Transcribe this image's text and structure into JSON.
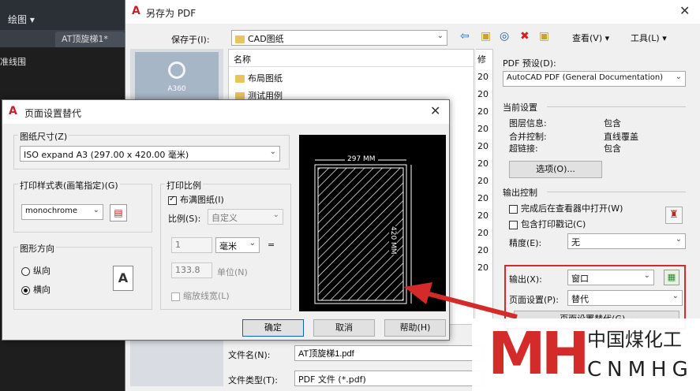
{
  "cad": {
    "menu_label": "绘图",
    "tab_label": "AT顶旋梯1*",
    "side_text": "准线围"
  },
  "save_dialog": {
    "title": "另存为 PDF",
    "save_in_label": "保存于(I):",
    "save_in_value": "CAD图纸",
    "view_label": "查看(V)",
    "tools_label": "工具(L)",
    "places": {
      "a360_label": "A360"
    },
    "list": {
      "name_header": "名称",
      "mod_header": "修",
      "items": [
        {
          "name": "布局图纸"
        },
        {
          "name": "测试用例"
        }
      ],
      "mod_values": [
        "20",
        "20",
        "20",
        "20",
        "20",
        "20",
        "20",
        "20",
        "20",
        "20",
        "20",
        "20"
      ]
    },
    "filename_label": "文件名(N):",
    "filename_value": "AT顶旋梯1.pdf",
    "filetype_label": "文件类型(T):",
    "filetype_value": "PDF 文件 (*.pdf)",
    "pdf_preset_label": "PDF 预设(D):",
    "pdf_preset_value": "AutoCAD PDF (General Documentation)",
    "current_settings": {
      "title": "当前设置",
      "rows": [
        {
          "key": "图层信息:",
          "value": "包含"
        },
        {
          "key": "合并控制:",
          "value": "直线覆盖"
        },
        {
          "key": "超链接:",
          "value": "包含"
        }
      ],
      "options_button": "选项(O)..."
    },
    "output_control": {
      "title": "输出控制",
      "open_after": "完成后在查看器中打开(W)",
      "include_stamp": "包含打印戳记(C)",
      "precision_label": "精度(E):",
      "precision_value": "无"
    },
    "output_label": "输出(X):",
    "output_value": "窗口",
    "page_setup_label": "页面设置(P):",
    "page_setup_value": "替代",
    "page_setup_override_button": "页面设置替代(G)..."
  },
  "override_dialog": {
    "title": "页面设置替代",
    "paper_size_label": "图纸尺寸(Z)",
    "paper_size_value": "ISO expand A3 (297.00 x 420.00 毫米)",
    "plot_style_label": "打印样式表(画笔指定)(G)",
    "plot_style_value": "monochrome",
    "orientation_label": "图形方向",
    "portrait_label": "纵向",
    "landscape_label": "横向",
    "orientation_icon_letter": "A",
    "plot_scale_label": "打印比例",
    "fit_paper_label": "布满图纸(I)",
    "scale_label": "比例(S):",
    "scale_value": "自定义",
    "scale_num": "1",
    "unit_value": "毫米",
    "equals": "=",
    "scale_den": "133.8",
    "unit_label": "单位(N)",
    "scale_lineweights_label": "缩放线宽(L)",
    "preview_width_label": "297 MM",
    "preview_height_label": "420 MM",
    "ok_button": "确定",
    "cancel_button": "取消",
    "help_button": "帮助(H)"
  },
  "watermark": {
    "mark": "MH",
    "cn_name": "中国煤化工",
    "en_name": "CNMHG"
  },
  "colors": {
    "accent_red": "#d42a2a",
    "logo_red": "#d32a2a"
  }
}
